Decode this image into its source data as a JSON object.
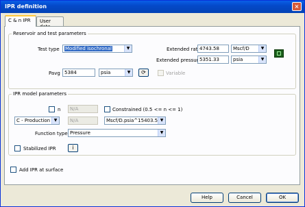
{
  "window": {
    "title": "IPR definition",
    "close_symbol": "×"
  },
  "tabs": [
    {
      "label": "C & n IPR",
      "active": true
    },
    {
      "label": "User data",
      "active": false
    }
  ],
  "reservoir": {
    "group_title": "Reservoir and test parameters",
    "test_type_label": "Test type",
    "test_type_value": "Modified isochronal",
    "extended_rate_label": "Extended rate",
    "extended_rate_value": "4743.58",
    "extended_rate_unit": "Mscf/D",
    "extended_pressure_label": "Extended pressure",
    "extended_pressure_value": "5351.33",
    "extended_pressure_unit": "psia",
    "pavg_label": "Pavg",
    "pavg_value": "5384",
    "pavg_unit": "psia",
    "variable_label": "Variable"
  },
  "model": {
    "group_title": "IPR model parameters",
    "n_label": "n",
    "n_value": "N/A",
    "constrained_label": "Constrained (0.5 <= n <= 1)",
    "c_select_value": "C - Production",
    "c_value": "N/A",
    "c_unit": "Mscf/D.psia^15403.5",
    "function_type_label": "Function type",
    "function_type_value": "Pressure",
    "stabilized_label": "Stabilized IPR"
  },
  "add_ipr_label": "Add IPR at surface",
  "buttons": {
    "help": "Help",
    "cancel": "Cancel",
    "ok": "OK"
  },
  "dropdown_arrow": "▼",
  "refresh_symbol": "⟳",
  "info_symbol": "i"
}
